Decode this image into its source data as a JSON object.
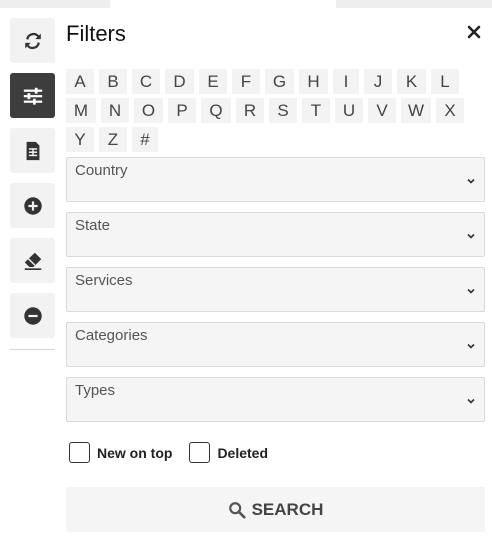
{
  "panel": {
    "title": "Filters"
  },
  "sidebar": {
    "items": [
      {
        "icon": "refresh-icon",
        "active": false
      },
      {
        "icon": "sliders-icon",
        "active": true
      },
      {
        "icon": "spreadsheet-icon",
        "active": false
      },
      {
        "icon": "plus-circle-icon",
        "active": false
      },
      {
        "icon": "eraser-icon",
        "active": false
      },
      {
        "icon": "minus-circle-icon",
        "active": false
      }
    ]
  },
  "letters": {
    "rows": [
      [
        "A",
        "B",
        "C",
        "D",
        "E",
        "F",
        "G",
        "H",
        "I",
        "J",
        "K",
        "L"
      ],
      [
        "M",
        "N",
        "O",
        "P",
        "Q",
        "R",
        "S",
        "T",
        "U",
        "V",
        "W",
        "X"
      ],
      [
        "Y",
        "Z",
        "#"
      ]
    ]
  },
  "dropdowns": {
    "country": {
      "label": "Country"
    },
    "state": {
      "label": "State"
    },
    "services": {
      "label": "Services"
    },
    "categories": {
      "label": "Categories"
    },
    "types": {
      "label": "Types"
    }
  },
  "checkboxes": {
    "new_on_top": {
      "label": "New on top",
      "checked": false
    },
    "deleted": {
      "label": "Deleted",
      "checked": false
    }
  },
  "search": {
    "label": "SEARCH"
  },
  "colors": {
    "active_button": "#3d3d3d",
    "icon": "#333333",
    "field_bg": "#f5f5f5"
  }
}
